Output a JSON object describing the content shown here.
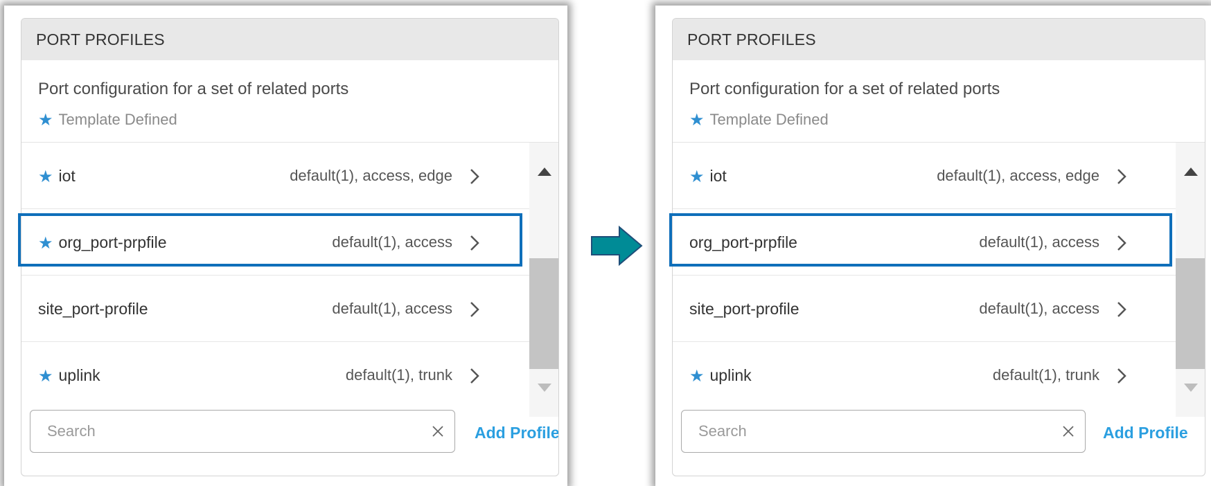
{
  "colors": {
    "accent": "#2b9fe0",
    "star": "#2f8fd1",
    "highlight_border": "#0f6fba",
    "arrow": "#008b96",
    "header_bg": "#e8e8e8"
  },
  "left": {
    "header": "PORT PROFILES",
    "description": "Port configuration for a set of related ports",
    "legend": "Template Defined",
    "rows": [
      {
        "name": "iot",
        "tags": "default(1), access, edge",
        "starred": true
      },
      {
        "name": "org_port-prpfile",
        "tags": "default(1), access",
        "starred": true,
        "highlighted": true
      },
      {
        "name": "site_port-profile",
        "tags": "default(1), access",
        "starred": false
      },
      {
        "name": "uplink",
        "tags": "default(1), trunk",
        "starred": true
      }
    ],
    "search_placeholder": "Search",
    "add_profile": "Add Profile"
  },
  "right": {
    "header": "PORT PROFILES",
    "description": "Port configuration for a set of related ports",
    "legend": "Template Defined",
    "rows": [
      {
        "name": "iot",
        "tags": "default(1), access, edge",
        "starred": true
      },
      {
        "name": "org_port-prpfile",
        "tags": "default(1), access",
        "starred": false,
        "highlighted": true
      },
      {
        "name": "site_port-profile",
        "tags": "default(1), access",
        "starred": false
      },
      {
        "name": "uplink",
        "tags": "default(1), trunk",
        "starred": true
      }
    ],
    "search_placeholder": "Search",
    "add_profile": "Add Profile"
  },
  "icons": {
    "star": "star-icon",
    "chevron": "chevron-right-icon",
    "clear": "close-icon",
    "scroll_up": "caret-up-icon",
    "scroll_down": "caret-down-icon",
    "transition": "arrow-right-icon"
  }
}
